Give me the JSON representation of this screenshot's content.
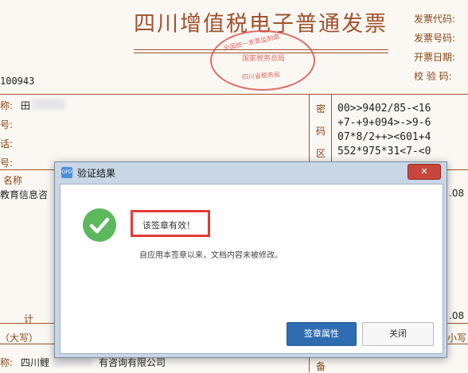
{
  "invoice": {
    "title": "四川增值税电子普通发票",
    "meta_labels": [
      "发票代码:",
      "发票号码:",
      "开票日期:",
      "校 验 码:"
    ],
    "number_prefix": "100943",
    "buyer_labels": [
      "称:",
      "号:",
      "话:",
      "号:"
    ],
    "buyer_name_partial": "田",
    "cipher_area_label": [
      "密",
      "码",
      "区"
    ],
    "cipher_lines": [
      "00>>9402/85-<16",
      "+7-+9+094>->9-6",
      "07*8/2++><601+4",
      "552*975*31<7-<0"
    ],
    "name_header": "名称",
    "item_partial": "教育信息咨",
    "right_partial_1": ".08",
    "total_label": "计",
    "right_partial_2": ".08",
    "amount_label": "（大写）",
    "small_label": "小写",
    "seller_label": "称:",
    "seller_name_a": "四川鲤",
    "seller_name_b": "有咨询有限公司",
    "bottom_right_label": "备"
  },
  "seal": {
    "top_text": "全国统一发票监制章",
    "mid_text": "国家税务总局",
    "bottom_text": "四川省税务局"
  },
  "dialog": {
    "app_icon_text": "OFD",
    "title": "验证结果",
    "close_glyph": "✕",
    "message": "该签章有效！",
    "detail": "自应用本签章以来，文档内容未被修改。",
    "primary_button": "签章属性",
    "secondary_button": "关闭"
  },
  "colors": {
    "accent": "#2f6db3",
    "success": "#5cb85c",
    "highlight": "#e53935",
    "invoice": "#a0522d"
  }
}
